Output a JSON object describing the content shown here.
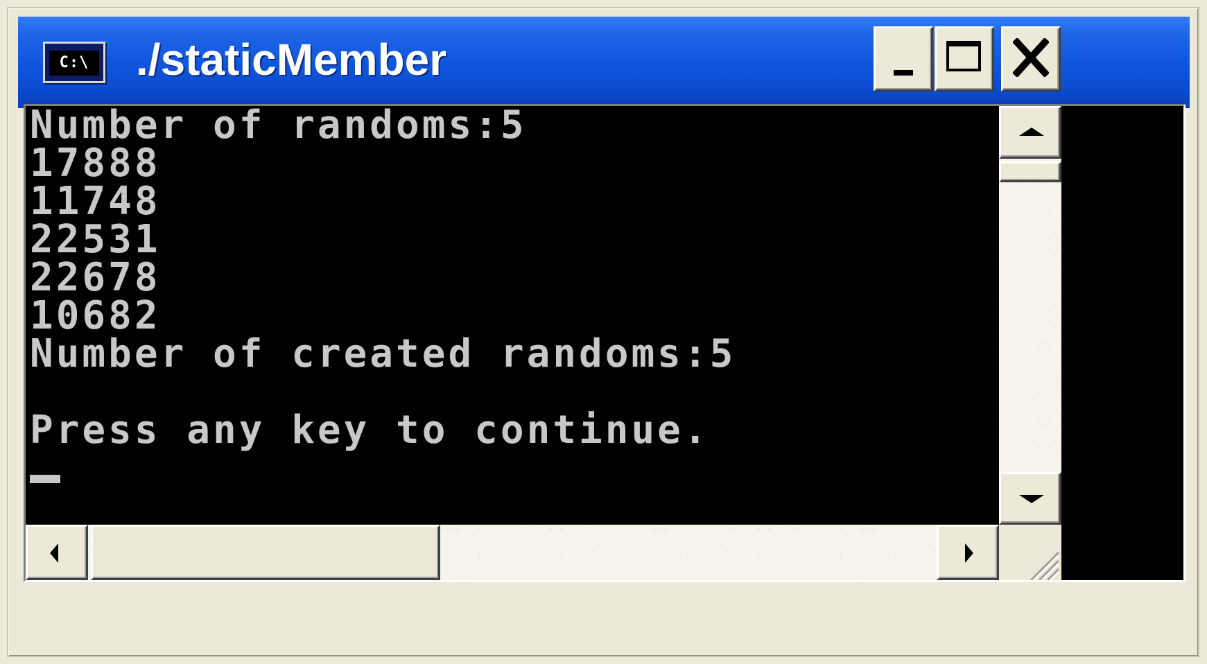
{
  "window": {
    "title": "./staticMember",
    "icon_name": "console-app-icon",
    "icon_text": "C:\\",
    "controls": {
      "minimize_icon": "minimize-icon",
      "maximize_icon": "maximize-icon",
      "close_icon": "close-icon"
    },
    "title_bar_color": "#0b4bcf"
  },
  "console": {
    "background": "#000000",
    "text_color": "#c8c8c8",
    "lines": [
      "Number of randoms:5",
      "17888",
      "11748",
      "22531",
      "22678",
      "10682",
      "Number of created randoms:5",
      "",
      "Press any key to continue."
    ],
    "cursor": "_"
  },
  "scrollbars": {
    "vertical": {
      "up_icon": "arrow-up-icon",
      "down_icon": "arrow-down-icon"
    },
    "horizontal": {
      "left_icon": "arrow-left-icon",
      "right_icon": "arrow-right-icon"
    },
    "size_grip_icon": "size-grip-icon"
  }
}
